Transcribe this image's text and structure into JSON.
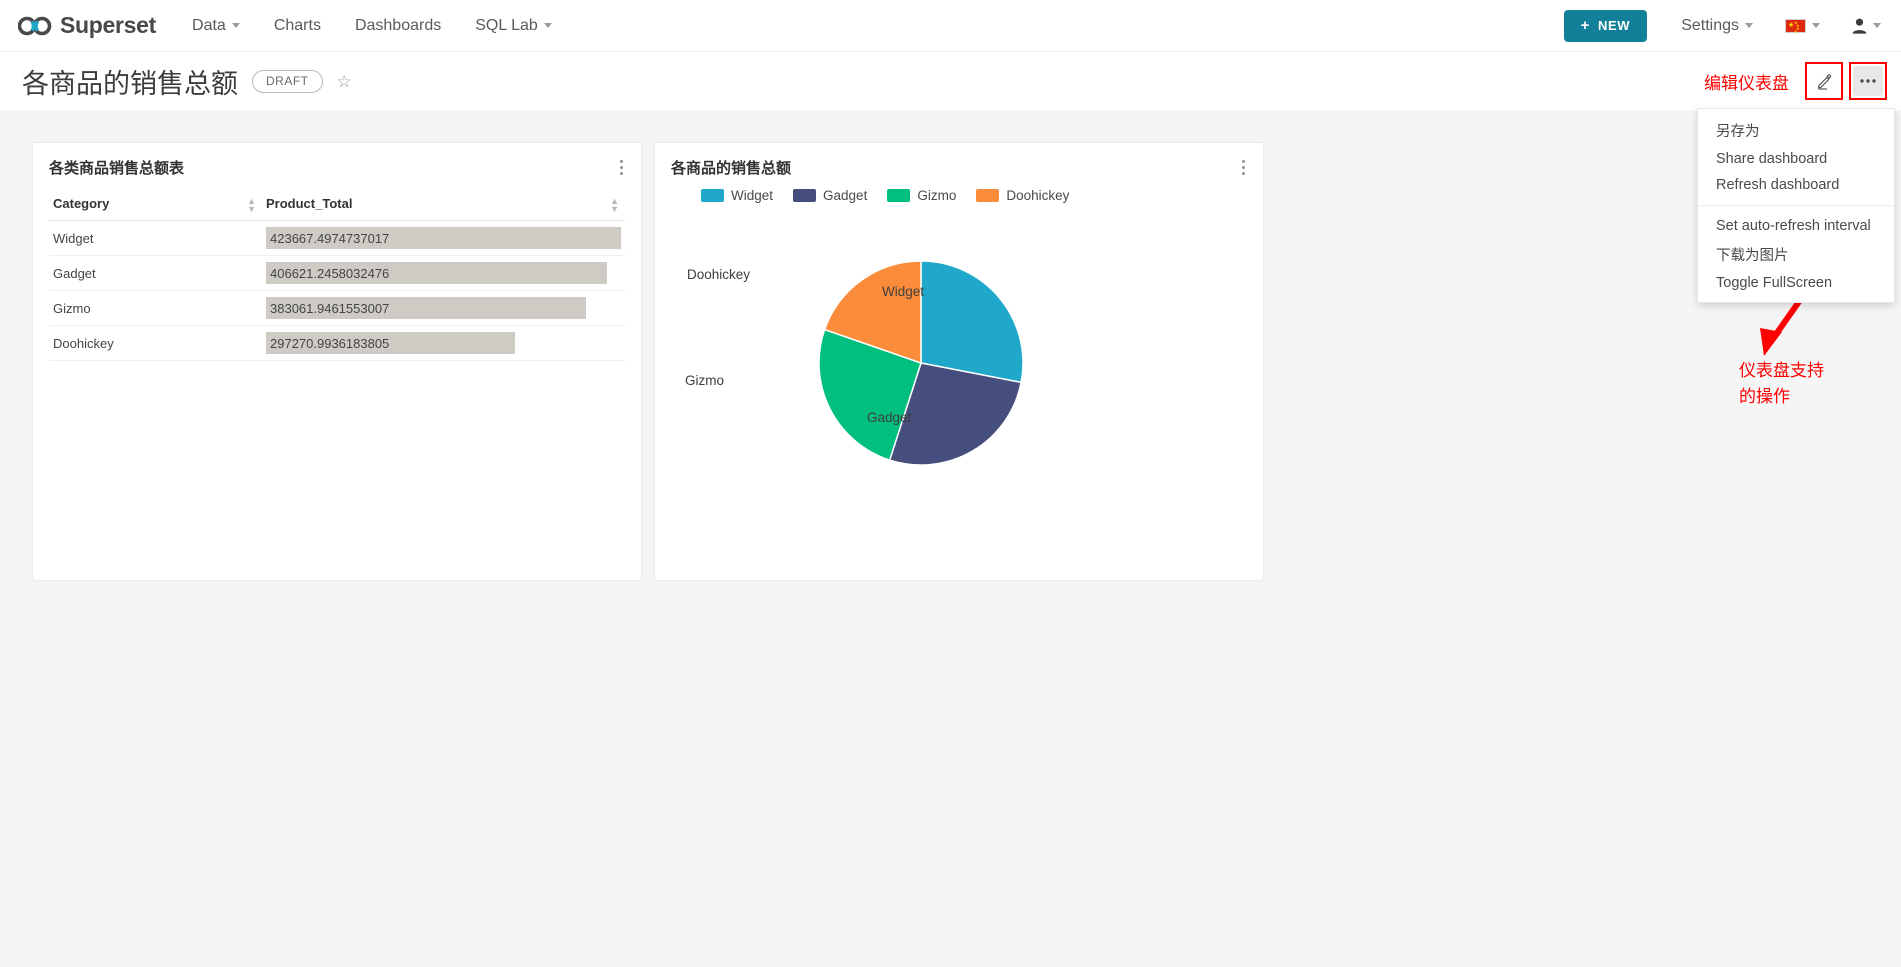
{
  "navbar": {
    "brand": "Superset",
    "brand_logo_icon": "superset-infinity-logo",
    "links": [
      {
        "label": "Data",
        "has_caret": true
      },
      {
        "label": "Charts",
        "has_caret": false
      },
      {
        "label": "Dashboards",
        "has_caret": false
      },
      {
        "label": "SQL Lab",
        "has_caret": true
      }
    ],
    "new_button": {
      "label": "NEW",
      "plus": "+",
      "color": "#128099"
    },
    "settings": {
      "label": "Settings",
      "has_caret": true
    },
    "language": {
      "icon": "china-flag-icon",
      "has_caret": true
    },
    "user": {
      "icon": "user-avatar-icon"
    }
  },
  "dashboard": {
    "title": "各商品的销售总额",
    "status_badge": "DRAFT",
    "favorite_icon": "star-outline-icon",
    "edit_icon": "pencil-edit-icon",
    "more_icon": "ellipsis-horizontal-icon"
  },
  "annotations": {
    "edit_label": "编辑仪表盘",
    "menu_note": "仪表盘支持\n的操作",
    "color": "#ff0000"
  },
  "dropdown_menu": {
    "items": [
      {
        "label": "另存为"
      },
      {
        "label": "Share dashboard"
      },
      {
        "label": "Refresh dashboard"
      },
      {
        "separator": true
      },
      {
        "label": "Set auto-refresh interval"
      },
      {
        "label": "下载为图片"
      },
      {
        "label": "Toggle FullScreen"
      }
    ]
  },
  "table_card": {
    "title": "各类商品销售总额表",
    "kebab_icon": "more-vertical-icon",
    "columns": [
      "Category",
      "Product_Total"
    ],
    "rows": [
      {
        "category": "Widget",
        "value": "423667.4974737017",
        "bar_pct": 100
      },
      {
        "category": "Gadget",
        "value": "406621.2458032476",
        "bar_pct": 96
      },
      {
        "category": "Gizmo",
        "value": "383061.9461553007",
        "bar_pct": 90
      },
      {
        "category": "Doohickey",
        "value": "297270.9936183805",
        "bar_pct": 70
      }
    ],
    "bar_color": "#cdcbc4"
  },
  "pie_card": {
    "title": "各商品的销售总额",
    "kebab_icon": "more-vertical-icon",
    "legend": [
      {
        "label": "Widget",
        "color": "#1fa8c9"
      },
      {
        "label": "Gadget",
        "color": "#454e7c"
      },
      {
        "label": "Gizmo",
        "color": "#00bf7f"
      },
      {
        "label": "Doohickey",
        "color": "#fb8c3b"
      }
    ]
  },
  "chart_data": {
    "type": "pie",
    "title": "各商品的销售总额",
    "categories": [
      "Widget",
      "Gadget",
      "Gizmo",
      "Doohickey"
    ],
    "values": [
      423667.4974737017,
      406621.2458032476,
      383061.9461553007,
      297270.9936183805
    ],
    "colors": [
      "#1fa8c9",
      "#454e7c",
      "#00bf7f",
      "#fb8c3b"
    ],
    "percents": [
      27.7,
      26.6,
      25.1,
      19.5
    ],
    "legend_position": "top",
    "labels_outside": true,
    "start_angle_deg": 0,
    "direction": "clockwise"
  }
}
